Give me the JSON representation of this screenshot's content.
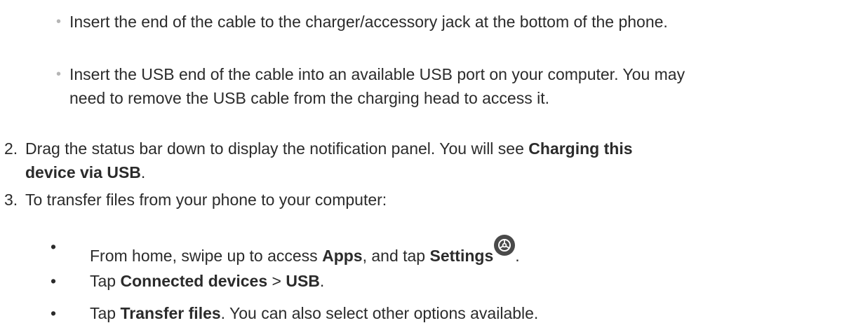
{
  "sub_steps_connect": [
    {
      "text": "Insert the end of the cable to the charger/accessory jack at the bottom of the phone."
    },
    {
      "line1": "Insert the USB end of the cable into an available USB port on your computer. You may",
      "line2": "need to remove the USB cable from the charging head to access it."
    }
  ],
  "step2": {
    "number": "2.",
    "text_a": "Drag the status bar down to display the notification panel. You will see ",
    "bold_a": "Charging this",
    "bold_b": "device via USB",
    "text_b": "."
  },
  "step3": {
    "number": "3.",
    "text": "To transfer files from your phone to your computer:",
    "sub_steps": [
      {
        "bullet": "•",
        "t1": "From home, swipe up to access ",
        "b1": "Apps",
        "t2": ", and tap ",
        "b2": "Settings",
        "icon": "settings-icon",
        "t3": "."
      },
      {
        "bullet": "•",
        "t1": "Tap ",
        "b1": "Connected devices",
        "t2": " > ",
        "b2": "USB",
        "t3": "."
      },
      {
        "bullet": "•",
        "t1": "Tap ",
        "b1": "Transfer files",
        "t2": ". You can also select other options available."
      }
    ]
  },
  "bullets": {
    "gray": "•"
  }
}
